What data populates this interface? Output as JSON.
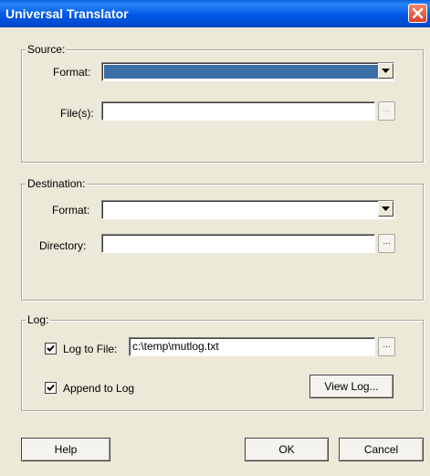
{
  "window": {
    "title": "Universal Translator"
  },
  "source": {
    "legend": "Source:",
    "format_label": "Format:",
    "format_value": "",
    "files_label": "File(s):",
    "files_value": "",
    "browse_label": "..."
  },
  "destination": {
    "legend": "Destination:",
    "format_label": "Format:",
    "format_value": "",
    "directory_label": "Directory:",
    "directory_value": "",
    "browse_label": "..."
  },
  "log": {
    "legend": "Log:",
    "log_to_file_label": "Log to File:",
    "log_to_file_checked": true,
    "log_file_value": "c:\\temp\\mutlog.txt",
    "browse_label": "...",
    "append_label": "Append to Log",
    "append_checked": true,
    "view_log_label": "View Log..."
  },
  "buttons": {
    "help": "Help",
    "ok": "OK",
    "cancel": "Cancel"
  },
  "colors": {
    "title_bar": "#0058e6",
    "close": "#d9412a",
    "dialog_bg": "#ece9d8",
    "selection": "#3a6ea5"
  },
  "icons": {
    "close": "close-icon",
    "dropdown": "chevron-down-icon",
    "check": "checkmark-icon"
  }
}
